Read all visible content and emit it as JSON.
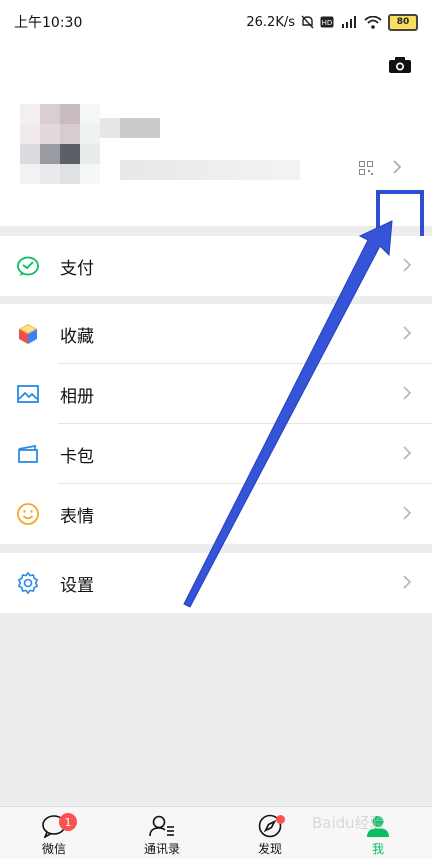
{
  "statusbar": {
    "time": "上午10:30",
    "speed": "26.2K/s",
    "battery": "80"
  },
  "menu": {
    "pay": "支付",
    "favorites": "收藏",
    "album": "相册",
    "cards": "卡包",
    "stickers": "表情",
    "settings": "设置"
  },
  "tabs": {
    "chats": "微信",
    "chats_badge": "1",
    "contacts": "通讯录",
    "discover": "发现",
    "me": "我"
  },
  "watermark": "Baidu经验",
  "colors": {
    "accent": "#07c160",
    "highlight": "#2e4fd1",
    "badge": "#fa5151"
  }
}
